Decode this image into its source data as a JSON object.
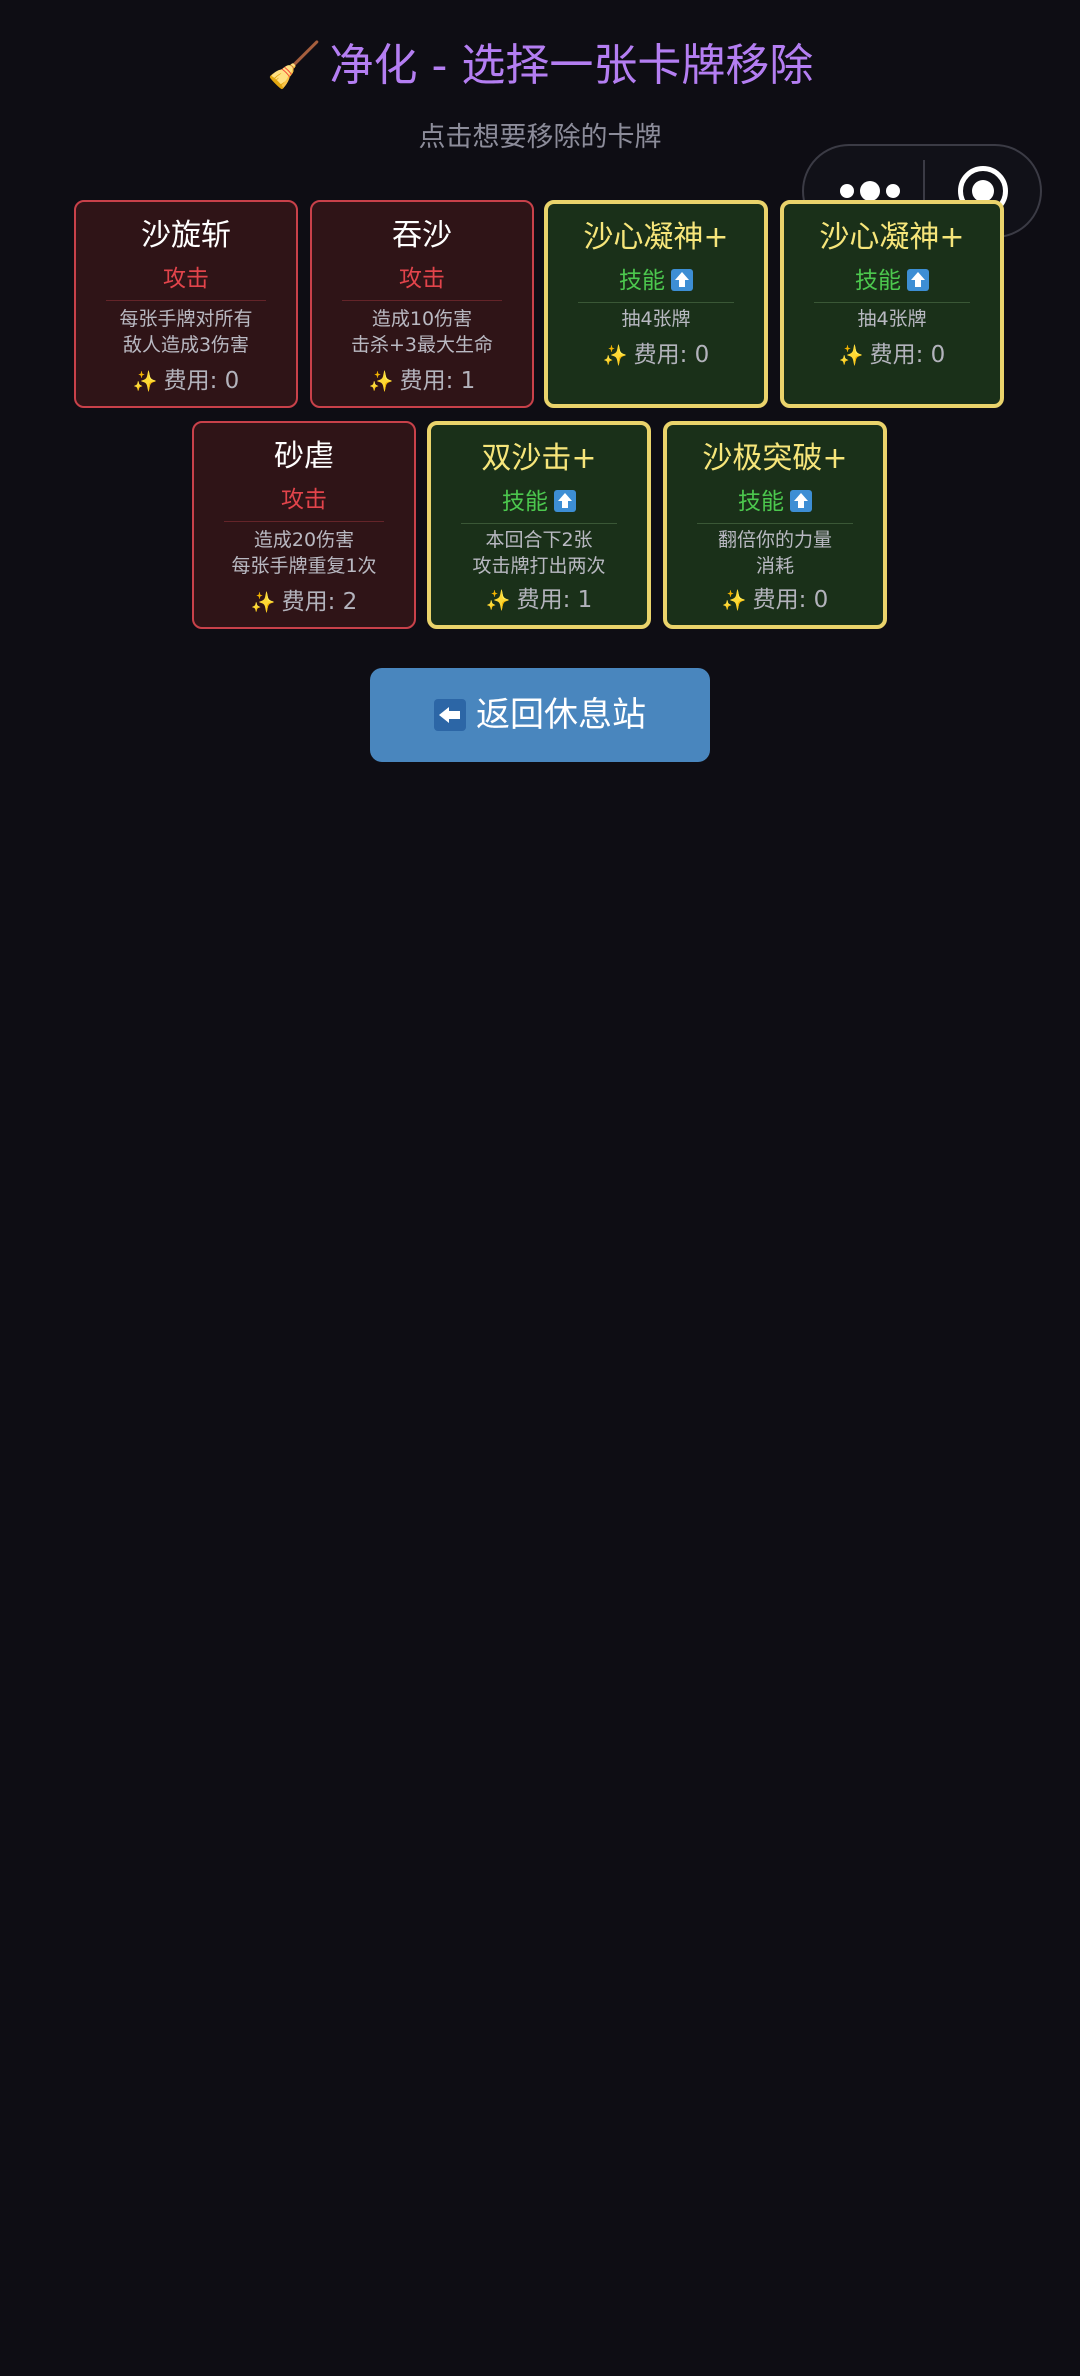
{
  "header": {
    "title_icon": "🧹",
    "title": "净化 - 选择一张卡牌移除",
    "subtitle": "点击想要移除的卡牌"
  },
  "capsule": {
    "more_icon": "more-dots-icon",
    "close_icon": "target-circle-icon"
  },
  "cards": [
    {
      "name": "沙旋斩",
      "type": "攻击",
      "kind": "attack",
      "desc": [
        "每张手牌对所有",
        "敌人造成3伤害"
      ],
      "cost_label": "费用: 0"
    },
    {
      "name": "吞沙",
      "type": "攻击",
      "kind": "attack",
      "desc": [
        "造成10伤害",
        "击杀+3最大生命"
      ],
      "cost_label": "费用: 1"
    },
    {
      "name": "沙心凝神+",
      "type": "技能",
      "kind": "skill",
      "upgraded": true,
      "desc": [
        "抽4张牌"
      ],
      "cost_label": "费用: 0"
    },
    {
      "name": "沙心凝神+",
      "type": "技能",
      "kind": "skill",
      "upgraded": true,
      "desc": [
        "抽4张牌"
      ],
      "cost_label": "费用: 0"
    },
    {
      "name": "砂虐",
      "type": "攻击",
      "kind": "attack",
      "desc": [
        "造成20伤害",
        "每张手牌重复1次"
      ],
      "cost_label": "费用: 2"
    },
    {
      "name": "双沙击+",
      "type": "技能",
      "kind": "skill",
      "upgraded": true,
      "desc": [
        "本回合下2张",
        "攻击牌打出两次"
      ],
      "cost_label": "费用: 1"
    },
    {
      "name": "沙极突破+",
      "type": "技能",
      "kind": "skill",
      "upgraded": true,
      "desc": [
        "翻倍你的力量",
        "消耗"
      ],
      "cost_label": "费用: 0"
    }
  ],
  "icons": {
    "cost": "✨",
    "upgrade": "upgrade-arrow-icon",
    "back": "back-arrow-icon"
  },
  "actions": {
    "return_label": "返回休息站"
  },
  "colors": {
    "background": "#0e0d14",
    "title": "#b47ef2",
    "attack_border": "#c8414a",
    "attack_type": "#e2444b",
    "skill_border": "#ead36b",
    "skill_type": "#4cc84e",
    "button": "#4986be"
  }
}
